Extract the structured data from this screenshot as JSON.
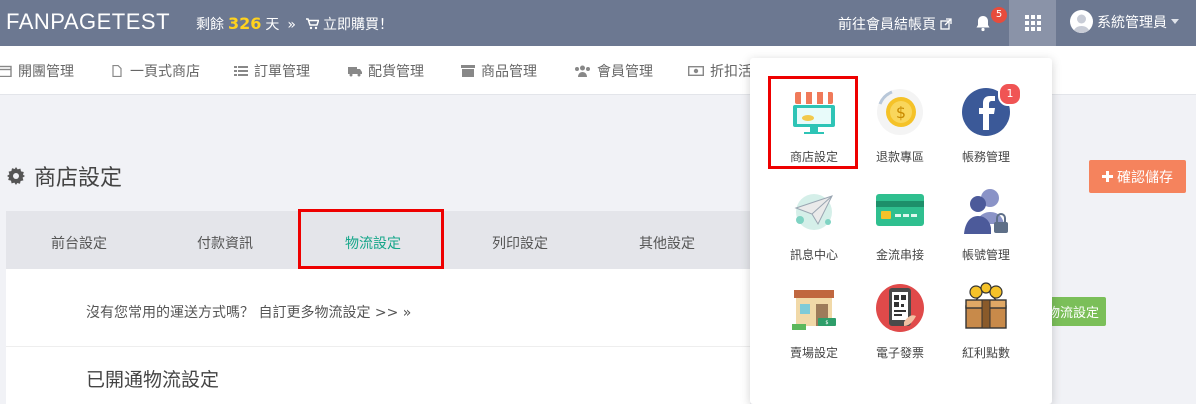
{
  "header": {
    "brand": "FANPAGETEST",
    "remain_prefix": "剩餘",
    "remain_days": "326",
    "remain_suffix": "天",
    "remain_sep": "»",
    "buy_now": "立即購買！",
    "member_checkout": "前往會員結帳頁",
    "notification_count": "5",
    "user_name": "系統管理員"
  },
  "nav": {
    "items": [
      {
        "label": "開團管理",
        "icon": "calendar-icon"
      },
      {
        "label": "一頁式商店",
        "icon": "file-icon"
      },
      {
        "label": "訂單管理",
        "icon": "list-icon"
      },
      {
        "label": "配貨管理",
        "icon": "truck-icon"
      },
      {
        "label": "商品管理",
        "icon": "archive-icon"
      },
      {
        "label": "會員管理",
        "icon": "users-icon"
      },
      {
        "label": "折扣活",
        "icon": "money-icon"
      }
    ]
  },
  "page": {
    "title": "商店設定",
    "save_label": "確認儲存",
    "tabs": [
      {
        "label": "前台設定"
      },
      {
        "label": "付款資訊"
      },
      {
        "label": "物流設定",
        "active": true
      },
      {
        "label": "列印設定"
      },
      {
        "label": "其他設定"
      }
    ],
    "custom_link": "沒有您常用的運送方式嗎？ 自訂更多物流設定 >> »",
    "section_title": "已開通物流設定",
    "green_button": "物流設定"
  },
  "apps_menu": {
    "items": [
      {
        "label": "商店設定",
        "icon": "shop-icon"
      },
      {
        "label": "退款專區",
        "icon": "refund-icon"
      },
      {
        "label": "帳務管理",
        "icon": "facebook-icon",
        "badge": "1"
      },
      {
        "label": "訊息中心",
        "icon": "message-icon"
      },
      {
        "label": "金流串接",
        "icon": "card-icon"
      },
      {
        "label": "帳號管理",
        "icon": "account-icon"
      },
      {
        "label": "賣場設定",
        "icon": "store-icon"
      },
      {
        "label": "電子發票",
        "icon": "einvoice-icon"
      },
      {
        "label": "紅利點數",
        "icon": "bonus-icon"
      }
    ]
  },
  "colors": {
    "topbar": "#6c7891",
    "accent_green": "#16a68a",
    "save_orange": "#f5835d",
    "highlight_red": "#ee0000"
  }
}
